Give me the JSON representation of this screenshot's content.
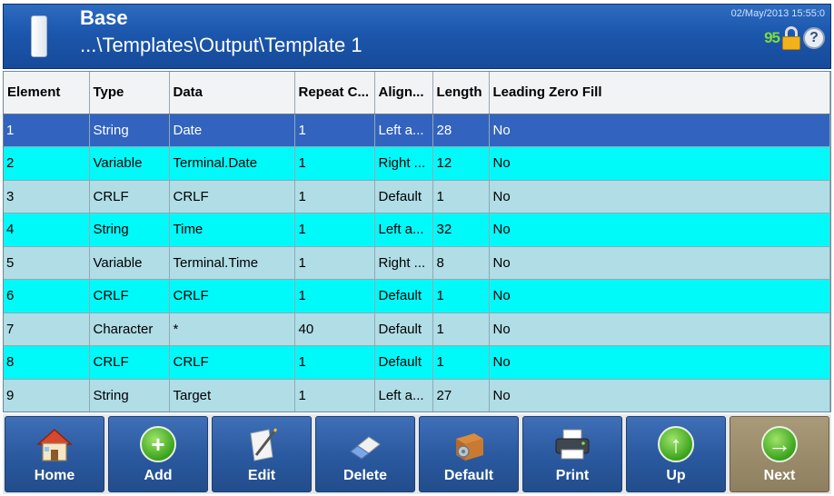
{
  "header": {
    "title": "Base",
    "path": "...\\Templates\\Output\\Template 1",
    "datetime": "02/May/2013 15:55:0",
    "status_number": "95",
    "help_glyph": "?"
  },
  "table": {
    "columns": [
      "Element",
      "Type",
      "Data",
      "Repeat C...",
      "Align...",
      "Length",
      "Leading Zero Fill"
    ],
    "rows": [
      {
        "element": "1",
        "type": "String",
        "data": "Date",
        "repeat": "1",
        "align": "Left a...",
        "length": "28",
        "lzf": "No"
      },
      {
        "element": "2",
        "type": "Variable",
        "data": "Terminal.Date",
        "repeat": "1",
        "align": "Right ...",
        "length": "12",
        "lzf": "No"
      },
      {
        "element": "3",
        "type": "CRLF",
        "data": "CRLF",
        "repeat": "1",
        "align": "Default",
        "length": "1",
        "lzf": "No"
      },
      {
        "element": "4",
        "type": "String",
        "data": "Time",
        "repeat": "1",
        "align": "Left a...",
        "length": "32",
        "lzf": "No"
      },
      {
        "element": "5",
        "type": "Variable",
        "data": "Terminal.Time",
        "repeat": "1",
        "align": "Right ...",
        "length": "8",
        "lzf": "No"
      },
      {
        "element": "6",
        "type": "CRLF",
        "data": "CRLF",
        "repeat": "1",
        "align": "Default",
        "length": "1",
        "lzf": "No"
      },
      {
        "element": "7",
        "type": "Character",
        "data": "*",
        "repeat": "40",
        "align": "Default",
        "length": "1",
        "lzf": "No"
      },
      {
        "element": "8",
        "type": "CRLF",
        "data": "CRLF",
        "repeat": "1",
        "align": "Default",
        "length": "1",
        "lzf": "No"
      },
      {
        "element": "9",
        "type": "String",
        "data": "Target",
        "repeat": "1",
        "align": "Left a...",
        "length": "27",
        "lzf": "No"
      }
    ],
    "selected_row": 0
  },
  "toolbar": {
    "home": "Home",
    "add": "Add",
    "edit": "Edit",
    "delete": "Delete",
    "default": "Default",
    "print": "Print",
    "up": "Up",
    "next": "Next"
  },
  "icons": {
    "tablet": "tablet-icon",
    "lock": "lock-icon",
    "help": "help-icon",
    "home": "house-icon",
    "add": "plus-icon",
    "edit": "pencil-paper-icon",
    "delete": "eraser-icon",
    "default": "box-gear-icon",
    "print": "printer-icon",
    "up": "arrow-up-icon",
    "next": "arrow-right-icon"
  },
  "colors": {
    "header_blue": "#1b57ad",
    "selected_row": "#3263bf",
    "alt_row": "#00f9f9",
    "normal_row": "#b0dde6",
    "button_blue": "#2b5aa1",
    "next_button": "#8d7f5f"
  }
}
